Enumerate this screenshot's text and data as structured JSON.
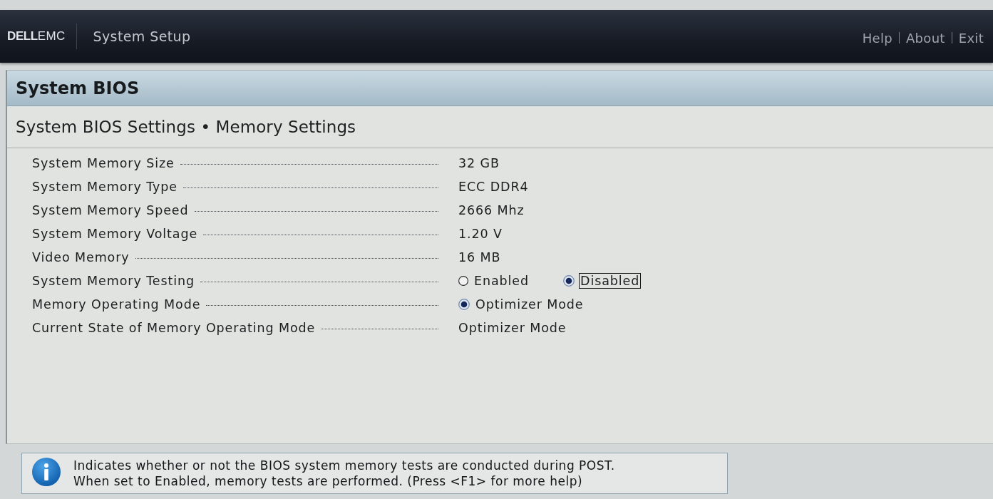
{
  "header": {
    "logo": "**DELL**EMC",
    "title": "System Setup",
    "links": [
      "Help",
      "About",
      "Exit"
    ]
  },
  "page": {
    "title": "System BIOS",
    "breadcrumb": "System BIOS Settings • Memory Settings"
  },
  "settings": [
    {
      "label": "System Memory Size",
      "kind": "text",
      "value": "32 GB"
    },
    {
      "label": "System Memory Type",
      "kind": "text",
      "value": "ECC DDR4"
    },
    {
      "label": "System Memory Speed",
      "kind": "text",
      "value": "2666 Mhz"
    },
    {
      "label": "System Memory Voltage",
      "kind": "text",
      "value": "1.20 V"
    },
    {
      "label": "Video Memory",
      "kind": "text",
      "value": "16 MB"
    },
    {
      "label": "System Memory Testing",
      "kind": "radio",
      "options": [
        {
          "label": "Enabled",
          "selected": false,
          "focused": false
        },
        {
          "label": "Disabled",
          "selected": true,
          "focused": true
        }
      ]
    },
    {
      "label": "Memory Operating Mode",
      "kind": "radio",
      "options": [
        {
          "label": "Optimizer Mode",
          "selected": true,
          "focused": false
        }
      ]
    },
    {
      "label": "Current State of Memory Operating Mode",
      "kind": "text",
      "value": "Optimizer Mode"
    }
  ],
  "help": {
    "lines": [
      "Indicates whether or not the BIOS system memory tests are conducted during POST.",
      "When set to Enabled, memory tests are performed. (Press <F1> for more help)"
    ]
  }
}
